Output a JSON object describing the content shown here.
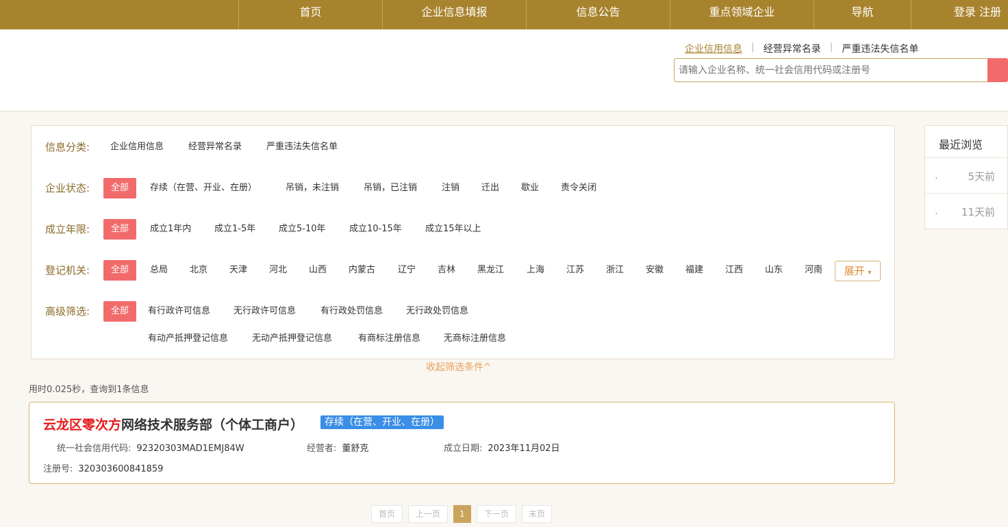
{
  "nav": {
    "items": [
      "首页",
      "企业信息填报",
      "信息公告",
      "重点领域企业",
      "导航"
    ],
    "login": "登录",
    "register": "注册"
  },
  "header": {
    "tabs": [
      "企业信用信息",
      "经营异常名录",
      "严重违法失信名单"
    ],
    "tab_separator": "|",
    "search_placeholder": "请输入企业名称、统一社会信用代码或注册号"
  },
  "filters": {
    "category": {
      "label": "信息分类:",
      "options": [
        "企业信用信息",
        "经营异常名录",
        "严重违法失信名单"
      ]
    },
    "status": {
      "label": "企业状态:",
      "options": [
        "全部",
        "存续（在营、开业、在册）",
        "吊销，未注销",
        "吊销，已注销",
        "注销",
        "迁出",
        "歇业",
        "责令关闭"
      ]
    },
    "years": {
      "label": "成立年限:",
      "options": [
        "全部",
        "成立1年内",
        "成立1-5年",
        "成立5-10年",
        "成立10-15年",
        "成立15年以上"
      ]
    },
    "authority": {
      "label": "登记机关:",
      "options": [
        "全部",
        "总局",
        "北京",
        "天津",
        "河北",
        "山西",
        "内蒙古",
        "辽宁",
        "吉林",
        "黑龙江",
        "上海",
        "江苏",
        "浙江",
        "安徽",
        "福建",
        "江西",
        "山东",
        "河南"
      ],
      "expand": "展开"
    },
    "advanced": {
      "label": "高级筛选:",
      "options": [
        "全部",
        "有行政许可信息",
        "无行政许可信息",
        "有行政处罚信息",
        "无行政处罚信息",
        "有动产抵押登记信息",
        "无动产抵押登记信息",
        "有商标注册信息",
        "无商标注册信息"
      ]
    },
    "collapse": "收起筛选条件^"
  },
  "results": {
    "stats": "用时0.025秒，查询到1条信息",
    "items": [
      {
        "name_highlight": "云龙区零次方",
        "name_rest": "网络技术服务部（个体工商户）",
        "status": "存续（在营、开业、在册）",
        "credit_code_label": "统一社会信用代码:",
        "credit_code": "92320303MAD1EMJ84W",
        "operator_label": "经营者:",
        "operator": "董舒克",
        "date_label": "成立日期:",
        "date": "2023年11月02日",
        "reg_label": "注册号:",
        "reg_no": "320303600841859"
      }
    ]
  },
  "pagination": {
    "first": "首页",
    "prev": "上一页",
    "current": "1",
    "next": "下一页",
    "last": "末页"
  },
  "recent": {
    "title": "最近浏览",
    "items": [
      {
        "dot": ".",
        "time": "5天前"
      },
      {
        "dot": ".",
        "time": "11天前"
      }
    ]
  },
  "colors": {
    "nav_bg": "#a8832e",
    "selected": "#f26b6b",
    "status_badge": "#3a8ee6",
    "highlight": "#e41a1a"
  }
}
